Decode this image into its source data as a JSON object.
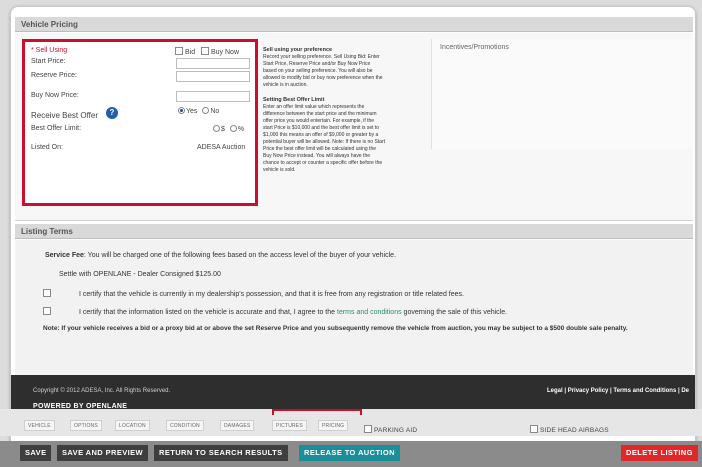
{
  "vehicle_pricing": {
    "title": "Vehicle Pricing",
    "sell_using": "* Sell Using",
    "bid": "Bid",
    "buy_now": "Buy Now",
    "start_price": "Start Price:",
    "reserve_price": "Reserve Price:",
    "buy_now_price": "Buy Now Price:",
    "receive_best_offer": "Receive Best Offer",
    "yes": "Yes",
    "no": "No",
    "best_offer_limit": "Best Offer Limit:",
    "dollar": "$",
    "percent": "%",
    "listed_on": "Listed On:",
    "listed_on_value": "ADESA Auction",
    "help": {
      "sell_title": "Sell using your preference",
      "sell_text": "Record your selling preference. Sell Using Bid: Enter Start Price, Reserve Price and/or Buy Now Price based on your selling preference. You will also be allowed to modify bid or buy now preference when the vehicle is in auction.",
      "best_title": "Setting Best Offer Limit",
      "best_text": "Enter an offer limit value which represents the difference between the start price and the minimum offer price you would entertain. For example, if the start Price is $10,000 and the best offer limit is set to $1,000 this means an offer of $9,000 or greater by a potential buyer will be allowed. Note: If there is no Start Price the best offer limit will be calculated using the Buy Now Price instead. You will always have the chance to accept or counter a specific offer before the vehicle is sold."
    },
    "incentives": "Incentives/Promotions"
  },
  "listing_terms": {
    "title": "Listing Terms",
    "service_fee_label": "Service Fee",
    "service_fee_text": ": You will be charged one of the following fees based on the access level of the buyer of your vehicle.",
    "settle": "Settle with OPENLANE - Dealer Consigned $125.00",
    "certify_1": "I certify that the vehicle is currently in my dealership's possession, and that it is free from any registration or title related fees.",
    "certify_2a": "I certify that the information listed on the vehicle is accurate and that, I agree to the",
    "certify_2_link": "terms and conditions",
    "certify_2b": "governing the sale of this vehicle.",
    "note": "Note: If your vehicle receives a bid or a proxy bid at or above the set Reserve Price and you subsequently remove the vehicle from auction, you may be subject to a $500 double sale penalty."
  },
  "footer": {
    "copyright": "Copyright © 2012 ADESA, Inc. All Rights Reserved.",
    "powered": "POWERED BY OPENLANE",
    "legal": "Legal",
    "privacy": "Privacy Policy",
    "terms": "Terms and Conditions",
    "de": "De"
  },
  "tabs": [
    "VEHICLE",
    "OPTIONS",
    "LOCATION",
    "CONDITION",
    "DAMAGES",
    "PICTURES",
    "PRICING"
  ],
  "behind_checkboxes": {
    "parking_aid": "PARKING AID",
    "side_airbags": "SIDE HEAD AIRBAGS"
  },
  "actions": {
    "save": "SAVE",
    "save_preview": "SAVE AND PREVIEW",
    "return": "RETURN TO SEARCH RESULTS",
    "release": "RELEASE TO AUCTION",
    "delete": "DELETE LISTING"
  }
}
